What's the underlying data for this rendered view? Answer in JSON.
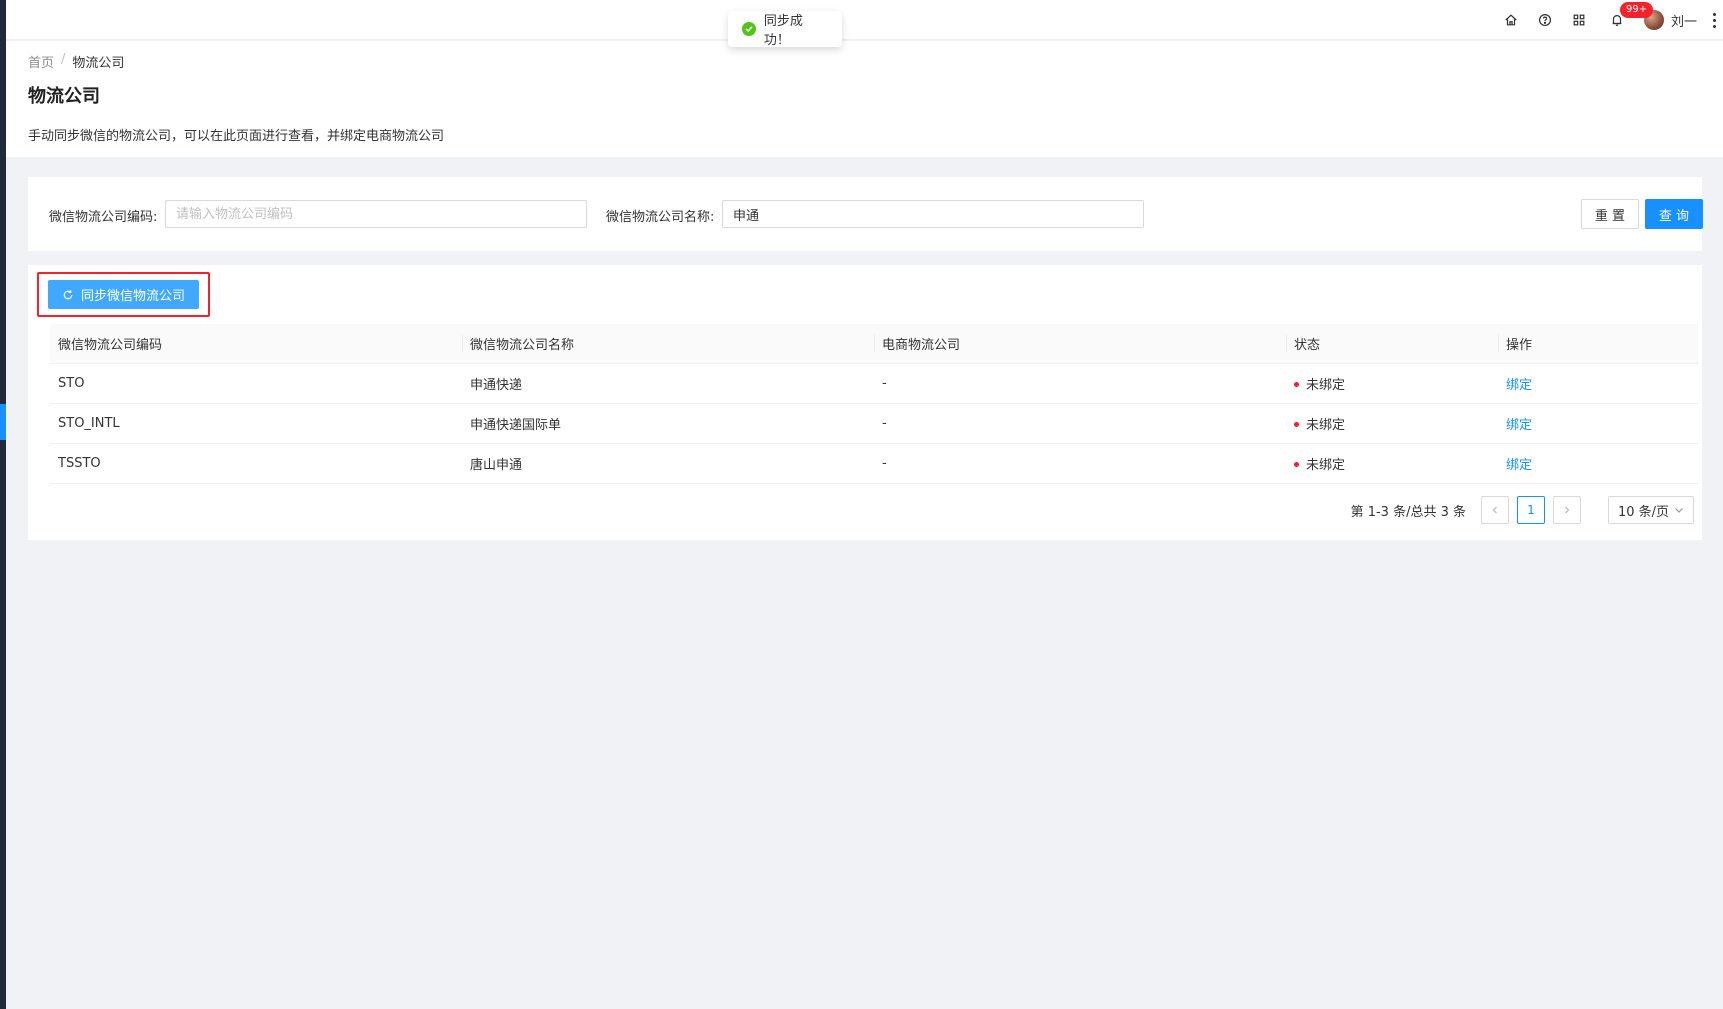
{
  "topbar": {
    "notification_badge": "99+",
    "username": "刘一",
    "icons": [
      "home-icon",
      "help-icon",
      "apps-icon",
      "bell-icon",
      "more-icon"
    ]
  },
  "toast": {
    "message": "同步成功！",
    "icon": "check-circle-icon"
  },
  "breadcrumb": {
    "home": "首页",
    "separator": "/",
    "current": "物流公司"
  },
  "page": {
    "title": "物流公司",
    "description": "手动同步微信的物流公司，可以在此页面进行查看，并绑定电商物流公司"
  },
  "search": {
    "code_label": "微信物流公司编码:",
    "code_placeholder": "请输入物流公司编码",
    "code_value": "",
    "name_label": "微信物流公司名称:",
    "name_value": "申通",
    "reset_label": "重 置",
    "query_label": "查 询"
  },
  "toolbar": {
    "sync_label": "同步微信物流公司"
  },
  "table": {
    "columns": [
      "微信物流公司编码",
      "微信物流公司名称",
      "电商物流公司",
      "状态",
      "操作"
    ],
    "rows": [
      {
        "code": "STO",
        "name": "申通快递",
        "ecom": "-",
        "status": "未绑定",
        "action": "绑定"
      },
      {
        "code": "STO_INTL",
        "name": "申通快递国际单",
        "ecom": "-",
        "status": "未绑定",
        "action": "绑定"
      },
      {
        "code": "TSSTO",
        "name": "唐山申通",
        "ecom": "-",
        "status": "未绑定",
        "action": "绑定"
      }
    ]
  },
  "pagination": {
    "total_text": "第 1-3 条/总共 3 条",
    "current_page": "1",
    "page_size": "10 条/页"
  },
  "colors": {
    "primary": "#1890ff",
    "danger": "#f5222d",
    "success": "#52c41a"
  }
}
